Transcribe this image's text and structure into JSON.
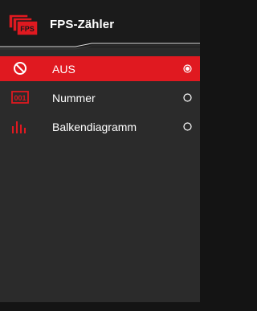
{
  "header": {
    "title": "FPS-Zähler",
    "icon": "fps-counter-icon",
    "icon_text": "FPS"
  },
  "options": [
    {
      "label": "AUS",
      "icon": "disabled-icon",
      "selected": true
    },
    {
      "label": "Nummer",
      "icon": "number-display-icon",
      "icon_text": "001",
      "selected": false
    },
    {
      "label": "Balkendiagramm",
      "icon": "bar-chart-icon",
      "selected": false
    }
  ],
  "colors": {
    "accent": "#e01920",
    "panel": "#2b2b2b",
    "header": "#1b1b1b",
    "text": "#ffffff"
  }
}
